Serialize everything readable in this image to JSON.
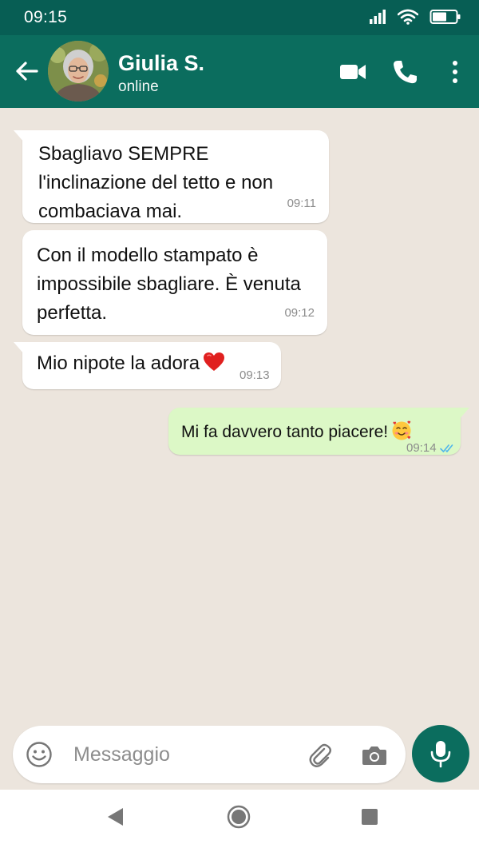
{
  "status_bar": {
    "time": "09:15",
    "icons": [
      "signal-icon",
      "wifi-icon",
      "battery-icon"
    ]
  },
  "header": {
    "contact_name": "Giulia S.",
    "contact_status": "online",
    "icons": [
      "back-arrow-icon",
      "video-call-icon",
      "phone-icon",
      "more-vert-icon"
    ]
  },
  "messages": [
    {
      "direction": "in",
      "text": "Sbagliavo SEMPRE l'inclinazione del tetto e non combaciava mai.",
      "time": "09:11"
    },
    {
      "direction": "in",
      "text": "Con il modello stampato è impossibile sbagliare. È venuta perfetta.",
      "time": "09:12"
    },
    {
      "direction": "in",
      "text": "Mio nipote la adora",
      "emoji": "red-heart",
      "time": "09:13"
    },
    {
      "direction": "out",
      "text": "Mi fa davvero tanto piacere!",
      "emoji": "smiling-face-with-hearts",
      "time": "09:14",
      "read_status": "read"
    }
  ],
  "composer": {
    "placeholder": "Messaggio",
    "icons": [
      "emoji-icon",
      "paperclip-icon",
      "camera-icon",
      "mic-icon"
    ]
  },
  "colors": {
    "header_bg": "#0b6d5e",
    "status_bar_bg": "#075e54",
    "chat_bg": "#ece5dd",
    "incoming_bubble": "#ffffff",
    "outgoing_bubble": "#dcf8c6",
    "read_ticks": "#4fb6ec"
  }
}
